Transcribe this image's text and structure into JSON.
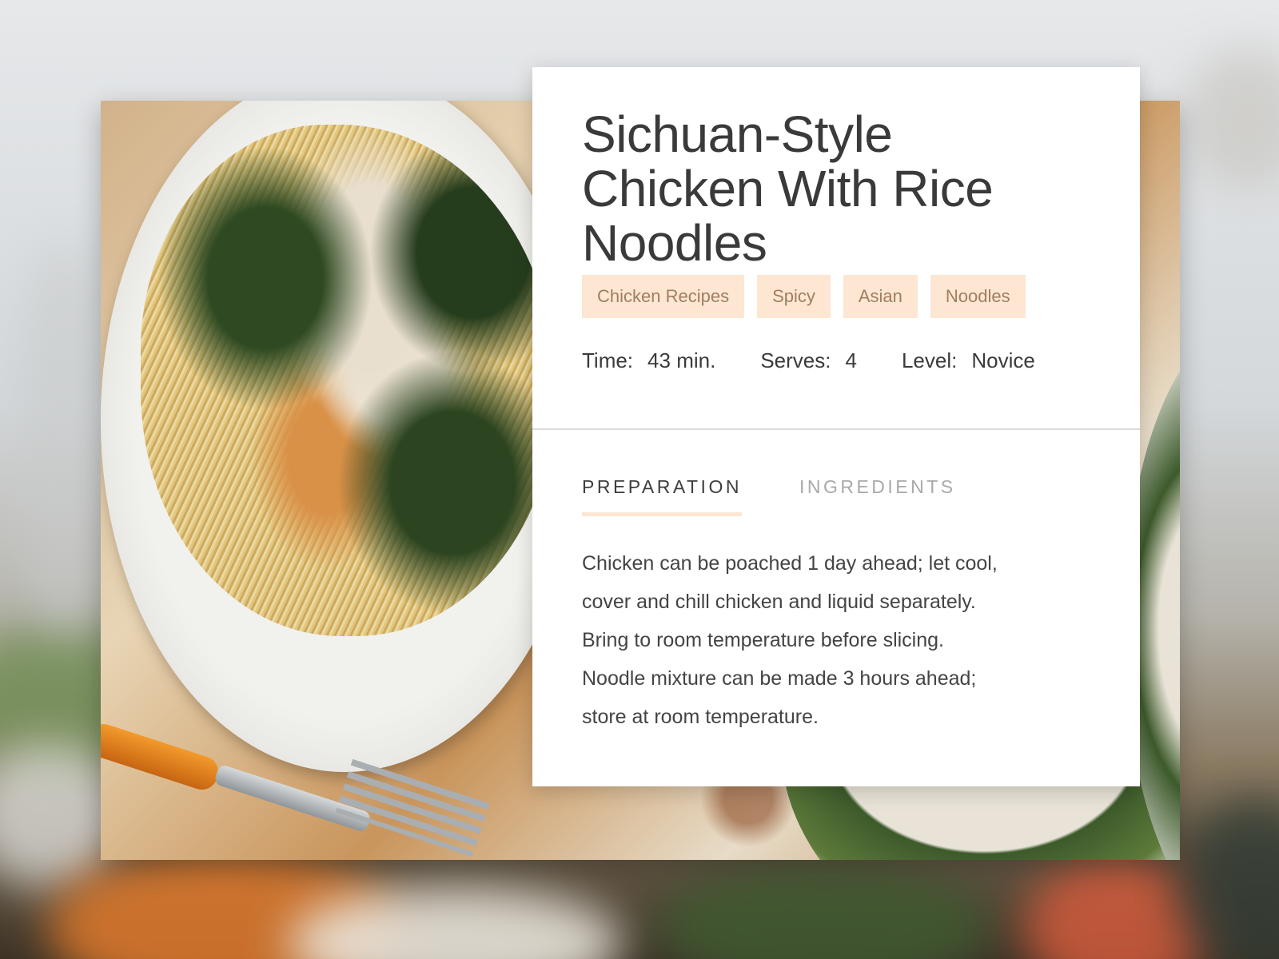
{
  "recipe": {
    "title": "Sichuan-Style Chicken With Rice Noodles",
    "tags": [
      "Chicken Recipes",
      "Spicy",
      "Asian",
      "Noodles"
    ],
    "meta": {
      "time_label": "Time:",
      "time_value": "43 min.",
      "serves_label": "Serves:",
      "serves_value": "4",
      "level_label": "Level:",
      "level_value": "Novice"
    },
    "tabs": [
      {
        "label": "PREPARATION",
        "active": true
      },
      {
        "label": "INGREDIENTS",
        "active": false
      }
    ],
    "preparation_lines": [
      "Chicken can be poached 1 day ahead; let cool,",
      "cover and chill chicken and liquid separately.",
      "Bring to room temperature before slicing.",
      "Noodle mixture can be made 3 hours ahead;",
      "store at room temperature."
    ]
  },
  "colors": {
    "tag_background": "#fde6d2",
    "tag_text": "#a07e60",
    "active_tab_underline": "#fde6d2",
    "card_background": "#ffffff",
    "heading_text": "#3a3a3a",
    "inactive_tab_text": "#a9a9a9"
  }
}
